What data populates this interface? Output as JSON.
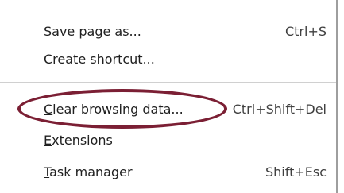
{
  "menu": {
    "items": [
      {
        "label_pre": "Save page ",
        "label_mn": "a",
        "label_post": "s...",
        "shortcut": "Ctrl+S"
      },
      {
        "label_pre": "Create shortcut...",
        "label_mn": "",
        "label_post": "",
        "shortcut": ""
      },
      {
        "label_pre": "",
        "label_mn": "C",
        "label_post": "lear browsing data...",
        "shortcut": "Ctrl+Shift+Del"
      },
      {
        "label_pre": "",
        "label_mn": "E",
        "label_post": "xtensions",
        "shortcut": ""
      },
      {
        "label_pre": "",
        "label_mn": "T",
        "label_post": "ask manager",
        "shortcut": "Shift+Esc"
      }
    ]
  },
  "annotation": {
    "type": "ellipse-highlight",
    "target": "Clear browsing data...",
    "color": "#7b1f34"
  }
}
